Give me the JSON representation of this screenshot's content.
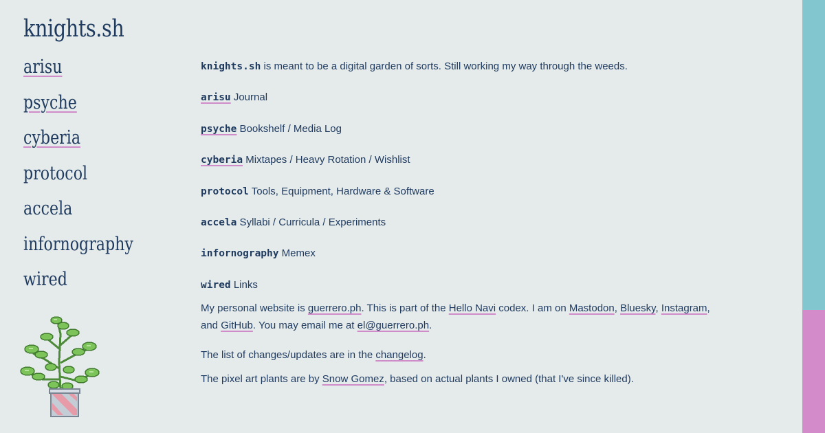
{
  "site": {
    "title": "knights.sh"
  },
  "nav": [
    {
      "label": "arisu",
      "underlined": true
    },
    {
      "label": "psyche",
      "underlined": true
    },
    {
      "label": "cyberia",
      "underlined": true
    },
    {
      "label": "protocol",
      "underlined": false
    },
    {
      "label": "accela",
      "underlined": false
    },
    {
      "label": "infornography",
      "underlined": false
    },
    {
      "label": "wired",
      "underlined": false
    }
  ],
  "intro": {
    "name": "knights.sh",
    "text": " is meant to be a digital garden of sorts. Still working my way through the weeds."
  },
  "sections": [
    {
      "key": "arisu",
      "desc": " Journal"
    },
    {
      "key": "psyche",
      "desc": " Bookshelf / Media Log"
    },
    {
      "key": "cyberia",
      "desc": " Mixtapes / Heavy Rotation / Wishlist"
    },
    {
      "key": "protocol",
      "desc": " Tools, Equipment, Hardware & Software"
    },
    {
      "key": "accela",
      "desc": " Syllabi / Curricula / Experiments"
    },
    {
      "key": "infornography",
      "desc": " Memex"
    },
    {
      "key": "wired",
      "desc": " Links"
    }
  ],
  "about": {
    "t1": "My personal website is ",
    "site_link": "guerrero.ph",
    "t2": ". This is part of the ",
    "codex_link": "Hello Navi",
    "t3": " codex. I am on ",
    "mastodon": "Mastodon",
    "c1": ", ",
    "bluesky": "Bluesky",
    "c2": ", ",
    "instagram": "Instagram",
    "t4": ",",
    "t5": "and ",
    "github": "GitHub",
    "t6": ". You may email me at ",
    "email": "el@guerrero.ph",
    "t7": "."
  },
  "changes": {
    "t1": "The list of changes/updates are in the ",
    "link": "changelog",
    "t2": "."
  },
  "credits": {
    "t1": "The pixel art plants are by ",
    "artist": "Snow Gomez",
    "t2": ", based on actual plants I owned (that I've since killed)."
  },
  "colors": {
    "background": "#e5eaea",
    "text": "#1e3a5f",
    "underline": "#d08cc8",
    "bar_top": "#82c6cf",
    "bar_bottom": "#d48bca"
  },
  "decoration": {
    "plant_image": "pixel-art potted plant"
  }
}
